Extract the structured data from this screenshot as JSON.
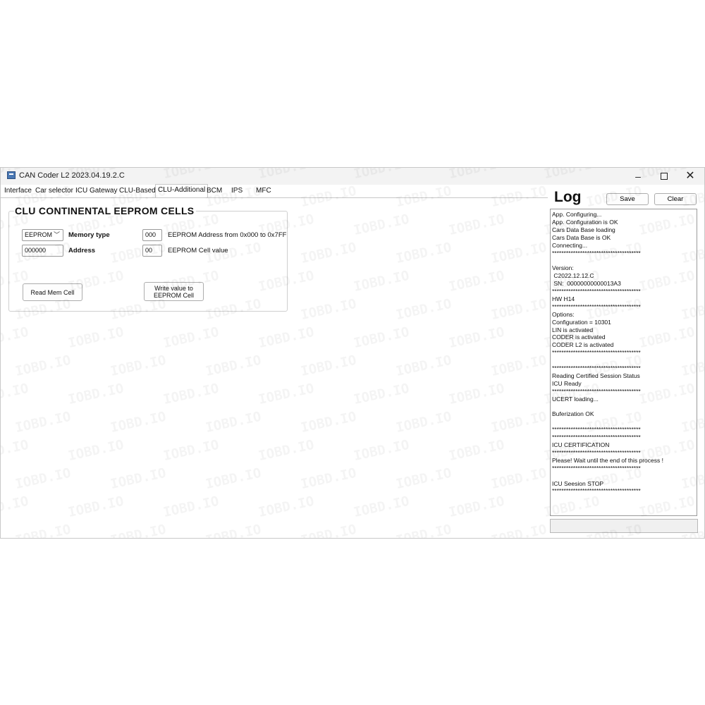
{
  "window": {
    "title": "CAN Coder L2 2023.04.19.2.C",
    "controls": {
      "minimize": "–",
      "close": "✕"
    }
  },
  "tabs": [
    {
      "label": "Interface"
    },
    {
      "label": "Car selector"
    },
    {
      "label": "ICU Gateway"
    },
    {
      "label": "CLU-Based"
    },
    {
      "label": "CLU-Additional",
      "active": true
    },
    {
      "label": "BCM"
    },
    {
      "label": "IPS"
    },
    {
      "label": "MFC"
    }
  ],
  "eeprom": {
    "group_title": "CLU CONTINENTAL EEPROM CELLS",
    "memory_type_value": "EEPROM",
    "memory_type_label": "Memory type",
    "address_value": "000000",
    "address_label": "Address",
    "range_value": "000",
    "range_label": "EEPROM Address from 0x000 to 0x7FF",
    "cell_value": "00",
    "cell_label": "EEPROM Cell value",
    "read_button": "Read Mem Cell",
    "write_button_line1": "Write value to",
    "write_button_line2": "EEPROM Cell"
  },
  "log": {
    "title": "Log",
    "save_button": "Save",
    "clear_button": "Clear",
    "lines": [
      "App. Configuring...",
      "App. Configuration is OK",
      "Cars Data Base loading",
      "Cars Data Base is OK",
      "Connecting...",
      "**************************************",
      "",
      "Version:",
      " C2022.12.12.C",
      " SN:  00000000000013A3",
      "**************************************",
      "HW H14",
      "**************************************",
      "Options:",
      "Configuration = 10301",
      "LIN is activated",
      "CODER is activated",
      "CODER L2 is activated",
      "**************************************",
      "",
      "**************************************",
      "Reading Certified Session Status",
      "ICU Ready",
      "**************************************",
      "UCERT loading...",
      "",
      "Buferization OK",
      "",
      "**************************************",
      "**************************************",
      "ICU CERTIFICATION",
      "**************************************",
      "Please! Wait until the end of this process !",
      "**************************************",
      "",
      "ICU Seesion STOP",
      "**************************************"
    ]
  },
  "watermark": "IOBD.IO",
  "colors": {
    "accent": "#4a78b4",
    "border": "#c8c8c8",
    "watermark": "#f0f0f0"
  }
}
